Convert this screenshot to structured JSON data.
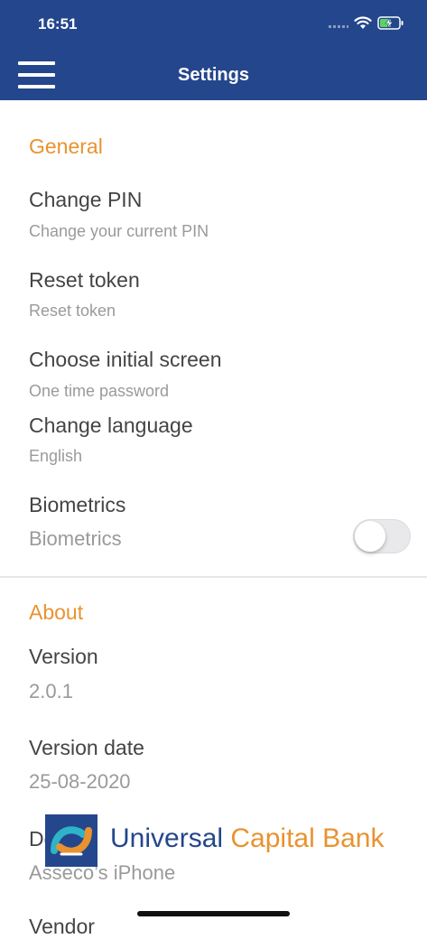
{
  "status_bar": {
    "time": "16:51"
  },
  "header": {
    "title": "Settings"
  },
  "general": {
    "title": "General",
    "items": [
      {
        "title": "Change PIN",
        "subtitle": "Change your current PIN"
      },
      {
        "title": "Reset token",
        "subtitle": "Reset token"
      },
      {
        "title": "Choose initial screen",
        "subtitle": "One time password"
      },
      {
        "title": "Change language",
        "subtitle": "English"
      },
      {
        "title": "Biometrics",
        "subtitle": "Biometrics"
      }
    ],
    "biometrics_enabled": false
  },
  "about": {
    "title": "About",
    "items": [
      {
        "title": "Version",
        "value": "2.0.1"
      },
      {
        "title": "Version date",
        "value": "25-08-2020"
      },
      {
        "title": "Device",
        "value": "Asseco’s iPhone"
      },
      {
        "title": "Vendor"
      }
    ]
  },
  "branding": {
    "word1": "Universal",
    "word2": "Capital Bank"
  },
  "colors": {
    "header": "#24468c",
    "accent": "#e8932f"
  }
}
